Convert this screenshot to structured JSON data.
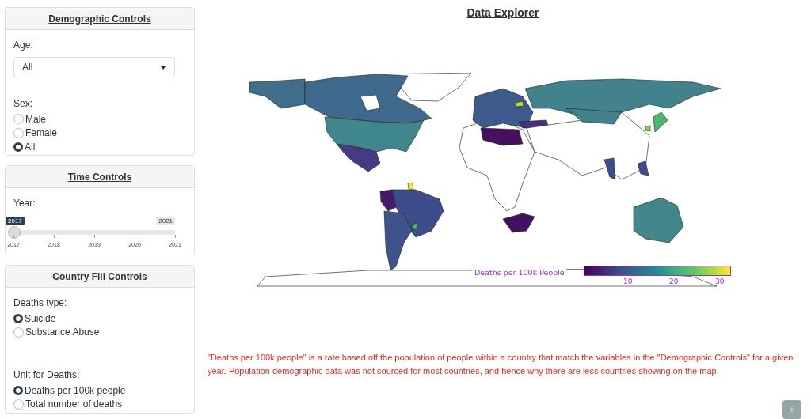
{
  "demographic_controls": {
    "title": "Demographic Controls",
    "age": {
      "label": "Age:",
      "value": "All"
    },
    "sex": {
      "label": "Sex:",
      "options": [
        {
          "label": "Male",
          "selected": false
        },
        {
          "label": "Female",
          "selected": false
        },
        {
          "label": "All",
          "selected": true
        }
      ]
    }
  },
  "time_controls": {
    "title": "Time Controls",
    "year": {
      "label": "Year:",
      "value": "2017",
      "max": "2021",
      "level": 0,
      "ticks": [
        "2017",
        "2018",
        "2019",
        "2020",
        "2021"
      ]
    }
  },
  "country_fill_controls": {
    "title": "Country Fill Controls",
    "deaths_type": {
      "label": "Deaths type:",
      "options": [
        {
          "label": "Suicide",
          "selected": true
        },
        {
          "label": "Substance Abuse",
          "selected": false
        }
      ]
    },
    "unit": {
      "label": "Unit for Deaths:",
      "options": [
        {
          "label": "Deaths per 100k people",
          "selected": true
        },
        {
          "label": "Total number of deaths",
          "selected": false
        }
      ]
    }
  },
  "explorer": {
    "title": "Data Explorer",
    "colorbar": {
      "title": "Deaths per 100k People",
      "ticks": [
        "10",
        "20",
        "30"
      ]
    },
    "note": "\"Deaths per 100k people\" is a rate based off the population of people within a country that match the variables in the \"Demographic Controls\" for a given year. Population demographic data was not sourced for most countries, and hence why there are less countries showing on the map.",
    "add_button": "+"
  }
}
